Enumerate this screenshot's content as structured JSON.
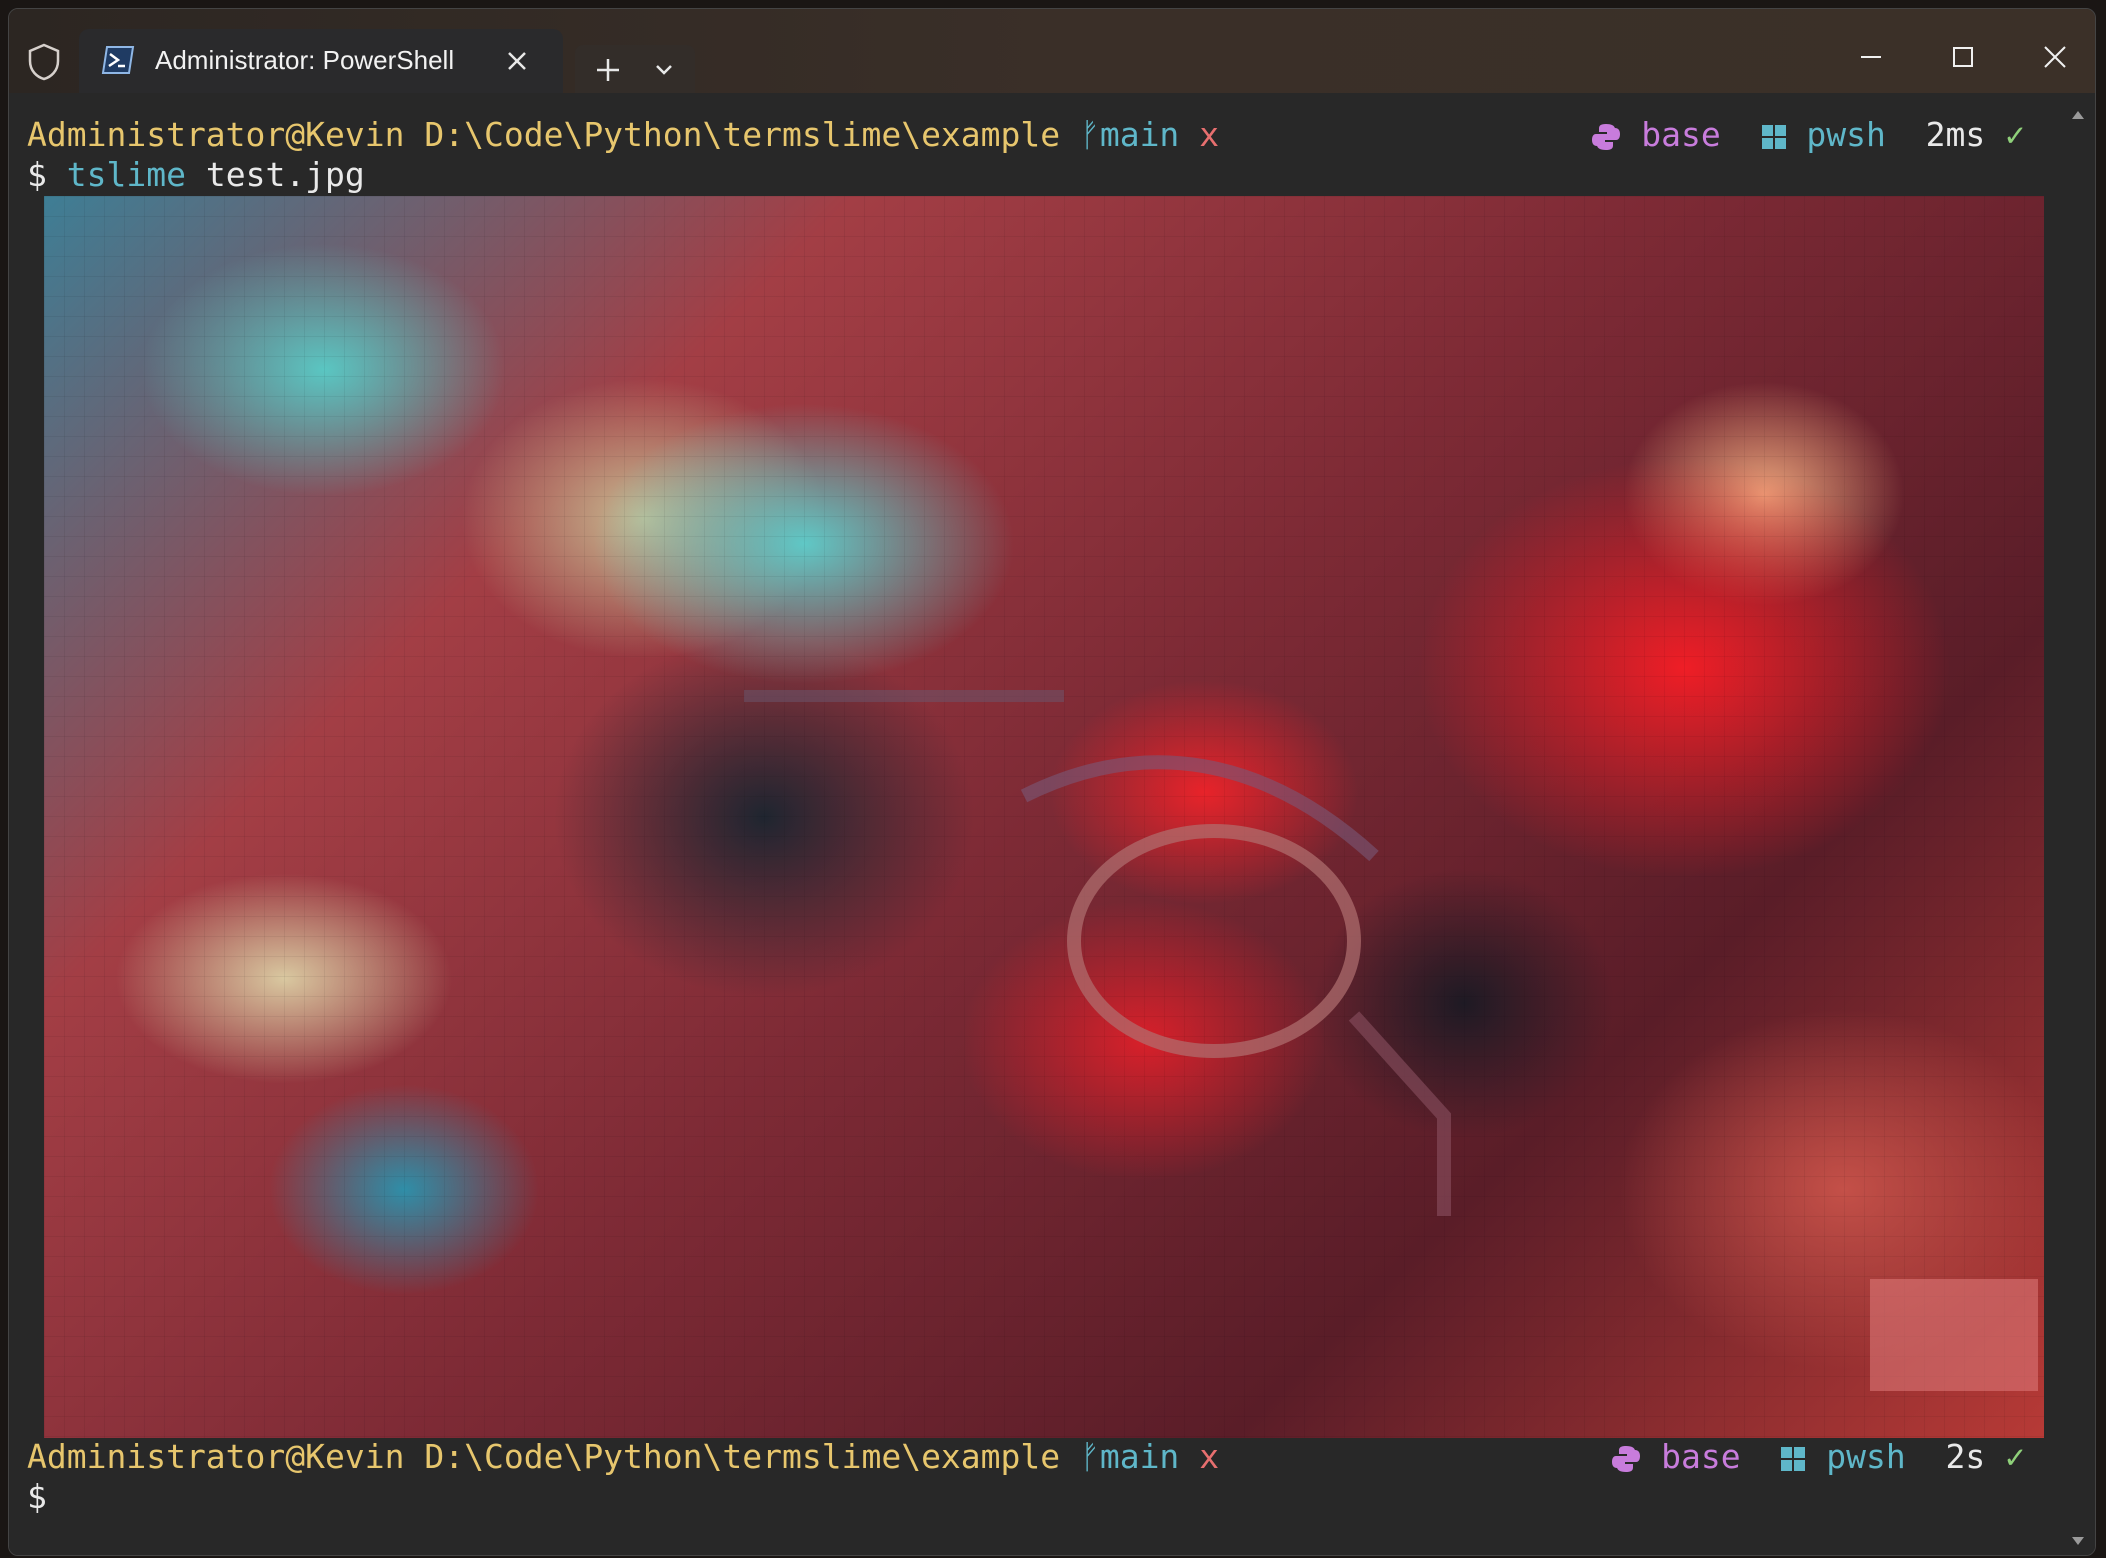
{
  "window": {
    "tab_title": "Administrator: PowerShell"
  },
  "prompt1": {
    "user": "Administrator@Kevin",
    "path": "D:\\Code\\Python\\termslime\\example",
    "branch_glyph": "ᚠ",
    "branch": "main",
    "dirty": "x",
    "env": "base",
    "shell": "pwsh",
    "duration": "2ms",
    "status": "✓",
    "dollar": "$",
    "command": "tslime",
    "argument": "test.jpg"
  },
  "prompt2": {
    "user": "Administrator@Kevin",
    "path": "D:\\Code\\Python\\termslime\\example",
    "branch_glyph": "ᚠ",
    "branch": "main",
    "dirty": "x",
    "env": "base",
    "shell": "pwsh",
    "duration": "2s",
    "status": "✓",
    "dollar": "$"
  },
  "icons": {
    "shield": "shield-icon",
    "powershell": "powershell-icon",
    "close_tab": "close-icon",
    "new_tab": "plus-icon",
    "dropdown": "chevron-down-icon",
    "minimize": "minimize-icon",
    "maximize": "maximize-icon",
    "close_window": "close-icon",
    "python": "python-icon",
    "windows": "windows-icon"
  },
  "colors": {
    "terminal_bg": "#282828",
    "prompt_user": "#e7c66d",
    "branch": "#5fb7c9",
    "dirty": "#e76f6f",
    "conda": "#c87cdc",
    "success": "#8fd07a"
  }
}
